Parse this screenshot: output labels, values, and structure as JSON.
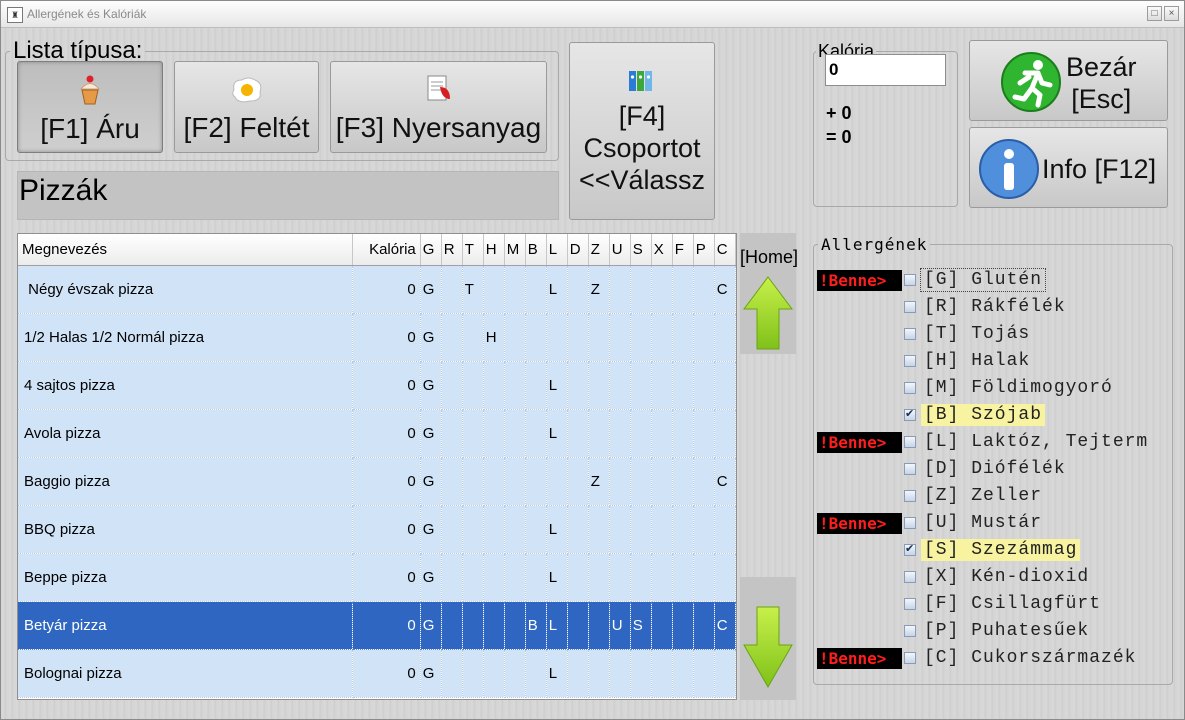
{
  "window": {
    "title": "Allergének és Kalóriák"
  },
  "list_type": {
    "legend": "Lista típusa:",
    "buttons": [
      {
        "label": "[F1] Áru",
        "icon": "cupcake-icon",
        "pressed": true
      },
      {
        "label": "[F2] Feltét",
        "icon": "fried-egg-icon",
        "pressed": false
      },
      {
        "label": "[F3] Nyersanyag",
        "icon": "ingredient-list-icon",
        "pressed": false
      }
    ]
  },
  "group_button": {
    "line1": "[F4]",
    "line2": "Csoportot",
    "line3": "<<Válassz",
    "icon": "binders-icon"
  },
  "category_title": "Pizzák",
  "calorie": {
    "legend": "Kalória",
    "value": "0",
    "plus": "+ 0",
    "equals": "= 0"
  },
  "close_button": {
    "line1": "Bezár",
    "line2": "[Esc]",
    "icon": "running-man-exit-icon"
  },
  "info_button": {
    "label": "Info [F12]",
    "icon": "info-icon"
  },
  "nav": {
    "home_label": "[Home]"
  },
  "table": {
    "columns": [
      "Megnevezés",
      "Kalória",
      "G",
      "R",
      "T",
      "H",
      "M",
      "B",
      "L",
      "D",
      "Z",
      "U",
      "S",
      "X",
      "F",
      "P",
      "C"
    ],
    "rows": [
      {
        "name": " Négy évszak pizza",
        "kal": "0",
        "flags": [
          "G",
          "",
          "T",
          "",
          "",
          "",
          "L",
          "",
          "Z",
          "",
          "",
          "",
          "",
          "",
          "C"
        ],
        "selected": false
      },
      {
        "name": "1/2 Halas 1/2 Normál pizza",
        "kal": "0",
        "flags": [
          "G",
          "",
          "",
          "H",
          "",
          "",
          "",
          "",
          "",
          "",
          "",
          "",
          "",
          "",
          ""
        ],
        "selected": false
      },
      {
        "name": "4 sajtos pizza",
        "kal": "0",
        "flags": [
          "G",
          "",
          "",
          "",
          "",
          "",
          "L",
          "",
          "",
          "",
          "",
          "",
          "",
          "",
          ""
        ],
        "selected": false
      },
      {
        "name": "Avola pizza",
        "kal": "0",
        "flags": [
          "G",
          "",
          "",
          "",
          "",
          "",
          "L",
          "",
          "",
          "",
          "",
          "",
          "",
          "",
          ""
        ],
        "selected": false
      },
      {
        "name": "Baggio pizza",
        "kal": "0",
        "flags": [
          "G",
          "",
          "",
          "",
          "",
          "",
          "",
          "",
          "Z",
          "",
          "",
          "",
          "",
          "",
          "C"
        ],
        "selected": false
      },
      {
        "name": "BBQ pizza",
        "kal": "0",
        "flags": [
          "G",
          "",
          "",
          "",
          "",
          "",
          "L",
          "",
          "",
          "",
          "",
          "",
          "",
          "",
          ""
        ],
        "selected": false
      },
      {
        "name": "Beppe pizza",
        "kal": "0",
        "flags": [
          "G",
          "",
          "",
          "",
          "",
          "",
          "L",
          "",
          "",
          "",
          "",
          "",
          "",
          "",
          ""
        ],
        "selected": false
      },
      {
        "name": "Betyár pizza",
        "kal": "0",
        "flags": [
          "G",
          "",
          "",
          "",
          "",
          "B",
          "L",
          "",
          "",
          "U",
          "S",
          "",
          "",
          "",
          "C"
        ],
        "selected": true
      },
      {
        "name": "Bolognai pizza",
        "kal": "0",
        "flags": [
          "G",
          "",
          "",
          "",
          "",
          "",
          "L",
          "",
          "",
          "",
          "",
          "",
          "",
          "",
          ""
        ],
        "selected": false
      }
    ]
  },
  "allergens": {
    "legend": "Allergének",
    "benne_label": "!Benne>",
    "items": [
      {
        "label": "[G] Glutén",
        "benne": true,
        "checked": false,
        "highlight": false,
        "focus": true
      },
      {
        "label": "[R] Rákfélék",
        "benne": false,
        "checked": false,
        "highlight": false,
        "focus": false
      },
      {
        "label": "[T] Tojás",
        "benne": false,
        "checked": false,
        "highlight": false,
        "focus": false
      },
      {
        "label": "[H] Halak",
        "benne": false,
        "checked": false,
        "highlight": false,
        "focus": false
      },
      {
        "label": "[M] Földimogyoró",
        "benne": false,
        "checked": false,
        "highlight": false,
        "focus": false
      },
      {
        "label": "[B] Szójab",
        "benne": false,
        "checked": true,
        "highlight": true,
        "focus": false
      },
      {
        "label": "[L] Laktóz, Tejterm",
        "benne": true,
        "checked": false,
        "highlight": false,
        "focus": false
      },
      {
        "label": "[D] Diófélék",
        "benne": false,
        "checked": false,
        "highlight": false,
        "focus": false
      },
      {
        "label": "[Z] Zeller",
        "benne": false,
        "checked": false,
        "highlight": false,
        "focus": false
      },
      {
        "label": "[U] Mustár",
        "benne": true,
        "checked": false,
        "highlight": false,
        "focus": false
      },
      {
        "label": "[S] Szezámmag",
        "benne": false,
        "checked": true,
        "highlight": true,
        "focus": false
      },
      {
        "label": "[X] Kén-dioxid",
        "benne": false,
        "checked": false,
        "highlight": false,
        "focus": false
      },
      {
        "label": "[F] Csillagfürt",
        "benne": false,
        "checked": false,
        "highlight": false,
        "focus": false
      },
      {
        "label": "[P] Puhatesűek",
        "benne": false,
        "checked": false,
        "highlight": false,
        "focus": false
      },
      {
        "label": "[C] Cukorszármazék",
        "benne": true,
        "checked": false,
        "highlight": false,
        "focus": false
      }
    ]
  }
}
